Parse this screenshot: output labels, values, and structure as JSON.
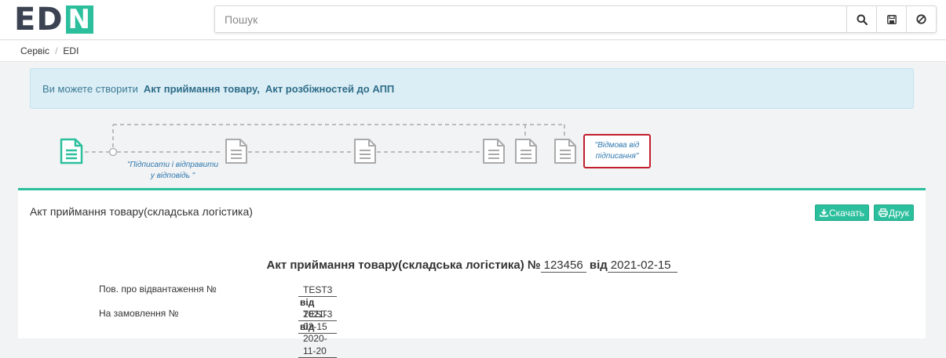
{
  "header": {
    "logo_left": "ED",
    "logo_right": "N",
    "search": {
      "placeholder": "Пошук",
      "value": ""
    },
    "icons": [
      "search-icon",
      "save-icon",
      "ban-icon"
    ]
  },
  "breadcrumb": {
    "items": [
      "Сервіс",
      "EDI"
    ]
  },
  "alert": {
    "text": "Ви можете створити",
    "link1": "Акт приймання товару,",
    "link2": "Акт розбіжностей до АПП"
  },
  "flow": {
    "sign_label_line1": "\"Підписати і відправити",
    "sign_label_line2": "у відповідь \"",
    "reject_line1": "\"Відмова від",
    "reject_line2": "підписання\"",
    "colors": {
      "active": "#2bbf9d",
      "inactive": "#aaaaaa",
      "reject_border": "#c21e2c"
    }
  },
  "panel": {
    "title": "Акт приймання товару(складська логістика)",
    "download_label": "Скачать",
    "print_label": "Друк"
  },
  "document": {
    "heading": "Акт приймання товару(складська логістика) №",
    "number": "123456",
    "from_word": "від",
    "date": "2021-02-15",
    "rows": [
      {
        "label": "Пов. про відвантаження №",
        "value": "TEST3",
        "from": "від",
        "date": "2021-02-15"
      },
      {
        "label": "На замовлення №",
        "value": "TEST3",
        "from": "від",
        "date": "2020-11-20"
      }
    ]
  }
}
